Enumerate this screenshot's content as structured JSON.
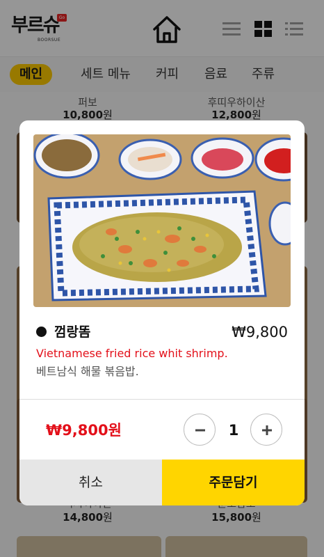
{
  "header": {
    "logo_text": "부르슈",
    "logo_sub": "BOORSUE",
    "logo_badge": "Go",
    "icons": [
      "home-icon",
      "list-view-icon",
      "grid-view-icon",
      "detail-list-icon"
    ]
  },
  "categories": [
    {
      "label": "메인",
      "active": true
    },
    {
      "label": "세트 메뉴",
      "active": false
    },
    {
      "label": "커피",
      "active": false
    },
    {
      "label": "음료",
      "active": false
    },
    {
      "label": "주류",
      "active": false
    }
  ],
  "background_products": [
    {
      "name": "퍼보",
      "price": "10,800",
      "unit": "원"
    },
    {
      "name": "후띠우하이산",
      "price": "12,800",
      "unit": "원"
    },
    {
      "name": "미시이이신",
      "price": "14,800",
      "unit": "원"
    },
    {
      "name": "군도담도",
      "price": "15,800",
      "unit": "원"
    }
  ],
  "modal": {
    "item_name": "껌랑똠",
    "item_price": "₩9,800",
    "description_en": "Vietnamese fried rice whit shrimp.",
    "description_ko": "베트남식 해물 볶음밥.",
    "total": "₩9,800원",
    "quantity": "1",
    "cancel_label": "취소",
    "add_to_cart_label": "주문담기"
  },
  "colors": {
    "accent_yellow": "#ffd500",
    "price_red": "#e3101a",
    "category_active": "#f5c400"
  }
}
